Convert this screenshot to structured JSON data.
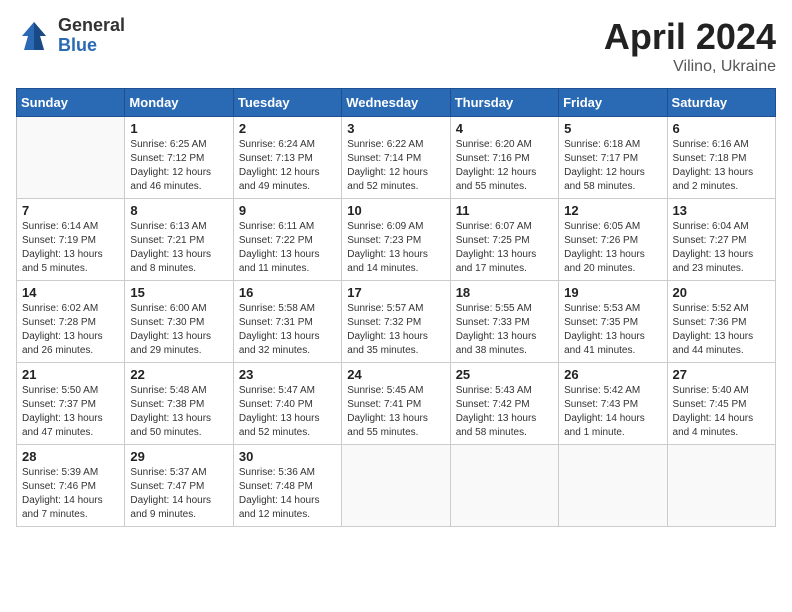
{
  "header": {
    "logo_general": "General",
    "logo_blue": "Blue",
    "title": "April 2024",
    "location": "Vilino, Ukraine"
  },
  "days_of_week": [
    "Sunday",
    "Monday",
    "Tuesday",
    "Wednesday",
    "Thursday",
    "Friday",
    "Saturday"
  ],
  "weeks": [
    [
      {
        "day": "",
        "info": ""
      },
      {
        "day": "1",
        "info": "Sunrise: 6:25 AM\nSunset: 7:12 PM\nDaylight: 12 hours\nand 46 minutes."
      },
      {
        "day": "2",
        "info": "Sunrise: 6:24 AM\nSunset: 7:13 PM\nDaylight: 12 hours\nand 49 minutes."
      },
      {
        "day": "3",
        "info": "Sunrise: 6:22 AM\nSunset: 7:14 PM\nDaylight: 12 hours\nand 52 minutes."
      },
      {
        "day": "4",
        "info": "Sunrise: 6:20 AM\nSunset: 7:16 PM\nDaylight: 12 hours\nand 55 minutes."
      },
      {
        "day": "5",
        "info": "Sunrise: 6:18 AM\nSunset: 7:17 PM\nDaylight: 12 hours\nand 58 minutes."
      },
      {
        "day": "6",
        "info": "Sunrise: 6:16 AM\nSunset: 7:18 PM\nDaylight: 13 hours\nand 2 minutes."
      }
    ],
    [
      {
        "day": "7",
        "info": "Sunrise: 6:14 AM\nSunset: 7:19 PM\nDaylight: 13 hours\nand 5 minutes."
      },
      {
        "day": "8",
        "info": "Sunrise: 6:13 AM\nSunset: 7:21 PM\nDaylight: 13 hours\nand 8 minutes."
      },
      {
        "day": "9",
        "info": "Sunrise: 6:11 AM\nSunset: 7:22 PM\nDaylight: 13 hours\nand 11 minutes."
      },
      {
        "day": "10",
        "info": "Sunrise: 6:09 AM\nSunset: 7:23 PM\nDaylight: 13 hours\nand 14 minutes."
      },
      {
        "day": "11",
        "info": "Sunrise: 6:07 AM\nSunset: 7:25 PM\nDaylight: 13 hours\nand 17 minutes."
      },
      {
        "day": "12",
        "info": "Sunrise: 6:05 AM\nSunset: 7:26 PM\nDaylight: 13 hours\nand 20 minutes."
      },
      {
        "day": "13",
        "info": "Sunrise: 6:04 AM\nSunset: 7:27 PM\nDaylight: 13 hours\nand 23 minutes."
      }
    ],
    [
      {
        "day": "14",
        "info": "Sunrise: 6:02 AM\nSunset: 7:28 PM\nDaylight: 13 hours\nand 26 minutes."
      },
      {
        "day": "15",
        "info": "Sunrise: 6:00 AM\nSunset: 7:30 PM\nDaylight: 13 hours\nand 29 minutes."
      },
      {
        "day": "16",
        "info": "Sunrise: 5:58 AM\nSunset: 7:31 PM\nDaylight: 13 hours\nand 32 minutes."
      },
      {
        "day": "17",
        "info": "Sunrise: 5:57 AM\nSunset: 7:32 PM\nDaylight: 13 hours\nand 35 minutes."
      },
      {
        "day": "18",
        "info": "Sunrise: 5:55 AM\nSunset: 7:33 PM\nDaylight: 13 hours\nand 38 minutes."
      },
      {
        "day": "19",
        "info": "Sunrise: 5:53 AM\nSunset: 7:35 PM\nDaylight: 13 hours\nand 41 minutes."
      },
      {
        "day": "20",
        "info": "Sunrise: 5:52 AM\nSunset: 7:36 PM\nDaylight: 13 hours\nand 44 minutes."
      }
    ],
    [
      {
        "day": "21",
        "info": "Sunrise: 5:50 AM\nSunset: 7:37 PM\nDaylight: 13 hours\nand 47 minutes."
      },
      {
        "day": "22",
        "info": "Sunrise: 5:48 AM\nSunset: 7:38 PM\nDaylight: 13 hours\nand 50 minutes."
      },
      {
        "day": "23",
        "info": "Sunrise: 5:47 AM\nSunset: 7:40 PM\nDaylight: 13 hours\nand 52 minutes."
      },
      {
        "day": "24",
        "info": "Sunrise: 5:45 AM\nSunset: 7:41 PM\nDaylight: 13 hours\nand 55 minutes."
      },
      {
        "day": "25",
        "info": "Sunrise: 5:43 AM\nSunset: 7:42 PM\nDaylight: 13 hours\nand 58 minutes."
      },
      {
        "day": "26",
        "info": "Sunrise: 5:42 AM\nSunset: 7:43 PM\nDaylight: 14 hours\nand 1 minute."
      },
      {
        "day": "27",
        "info": "Sunrise: 5:40 AM\nSunset: 7:45 PM\nDaylight: 14 hours\nand 4 minutes."
      }
    ],
    [
      {
        "day": "28",
        "info": "Sunrise: 5:39 AM\nSunset: 7:46 PM\nDaylight: 14 hours\nand 7 minutes."
      },
      {
        "day": "29",
        "info": "Sunrise: 5:37 AM\nSunset: 7:47 PM\nDaylight: 14 hours\nand 9 minutes."
      },
      {
        "day": "30",
        "info": "Sunrise: 5:36 AM\nSunset: 7:48 PM\nDaylight: 14 hours\nand 12 minutes."
      },
      {
        "day": "",
        "info": ""
      },
      {
        "day": "",
        "info": ""
      },
      {
        "day": "",
        "info": ""
      },
      {
        "day": "",
        "info": ""
      }
    ]
  ]
}
